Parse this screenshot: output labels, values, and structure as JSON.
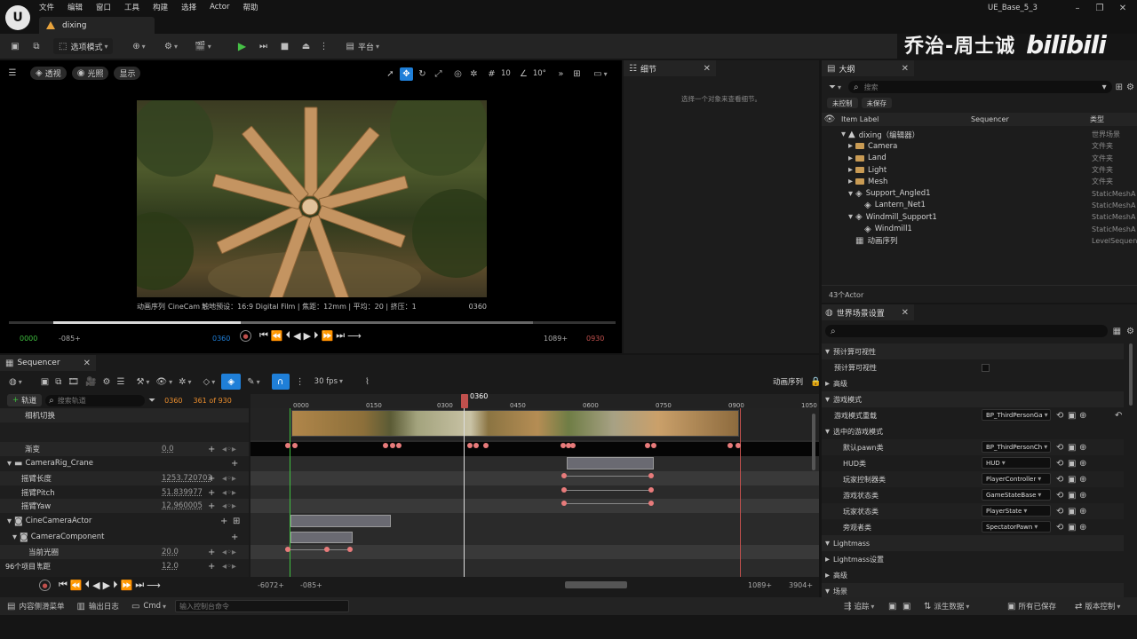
{
  "menu": {
    "items": [
      "文件",
      "编辑",
      "窗口",
      "工具",
      "构建",
      "选择",
      "Actor",
      "帮助"
    ]
  },
  "window": {
    "project": "UE_Base_5_3",
    "level_tab": "dixing"
  },
  "watermark": {
    "text": "乔治-周士诚",
    "logo": "bilibili"
  },
  "toolbar": {
    "mode": "选项模式",
    "platform": "平台"
  },
  "viewport": {
    "perspective": "透视",
    "lighting": "光照",
    "show": "显示",
    "grid_value": "10",
    "angle_value": "10°",
    "caption_left": "动画序列",
    "caption_mid": "CineCam",
    "caption_info": "触地预设：16:9 Digital Film | 焦距：12mm | 平均：20 | 挤压：1",
    "caption_frame": "0360",
    "scrub_start": "0000",
    "scrub_prev": "-085+",
    "scrub_current": "0360",
    "scrub_next": "1089+",
    "scrub_end": "0930",
    "scrub_progress": 0.39
  },
  "details": {
    "title": "细节",
    "empty_text": "选择一个对象来查看细节。"
  },
  "outliner": {
    "title": "大纲",
    "search_placeholder": "搜索",
    "filter_uncontrolled": "未控制",
    "filter_unsaved": "未保存",
    "col_label": "Item Label",
    "col_sequencer": "Sequencer",
    "col_type": "类型",
    "items": [
      {
        "label": "dixing（编辑器）",
        "type": "世界场景"
      },
      {
        "label": "Camera",
        "type": "文件夹"
      },
      {
        "label": "Land",
        "type": "文件夹"
      },
      {
        "label": "Light",
        "type": "文件夹"
      },
      {
        "label": "Mesh",
        "type": "文件夹"
      },
      {
        "label": "Support_Angled1",
        "type": "StaticMeshA"
      },
      {
        "label": "Lantern_Net1",
        "type": "StaticMeshA"
      },
      {
        "label": "Windmill_Support1",
        "type": "StaticMeshA"
      },
      {
        "label": "Windmill1",
        "type": "StaticMeshA"
      },
      {
        "label": "动画序列",
        "type": "LevelSequen"
      }
    ],
    "count": "43个Actor"
  },
  "world_settings": {
    "title": "世界场景设置",
    "search_placeholder": "",
    "sections": {
      "precompute": "预计算可视性",
      "precompute_prop": "预计算可视性",
      "advanced": "高级",
      "game_mode": "游戏模式",
      "game_mode_override": "游戏模式重载",
      "selected_game_mode": "选中的游戏模式",
      "lightmass": "Lightmass",
      "lightmass_settings": "Lightmass设置",
      "advanced2": "高级",
      "world": "场景"
    },
    "props": [
      {
        "label": "默认pawn类",
        "value": "BP_ThirdPersonCh"
      },
      {
        "label": "HUD类",
        "value": "HUD"
      },
      {
        "label": "玩家控制器类",
        "value": "PlayerController"
      },
      {
        "label": "游戏状态类",
        "value": "GameStateBase"
      },
      {
        "label": "玩家状态类",
        "value": "PlayerState"
      },
      {
        "label": "旁观者类",
        "value": "SpectatorPawn"
      }
    ],
    "game_mode_value": "BP_ThirdPersonGa"
  },
  "sequencer": {
    "tab": "Sequencer",
    "fps": "30 fps",
    "sequence_name": "动画序列",
    "add_track": "轨道",
    "search_placeholder": "搜索轨道",
    "current_frame": "0360",
    "frame_of": "361 of 930",
    "playhead_label": "0360",
    "ruler": [
      "0000",
      "0150",
      "0300",
      "0450",
      "0600",
      "0750",
      "0900",
      "1050"
    ],
    "tracks": [
      {
        "label": "相机切换",
        "value": ""
      },
      {
        "label": "渐变",
        "value": "0.0"
      },
      {
        "label": "CameraRig_Crane",
        "value": ""
      },
      {
        "label": "摇臂长度",
        "value": "1253.720703"
      },
      {
        "label": "摇臂Pitch",
        "value": "51.839977"
      },
      {
        "label": "摇臂Yaw",
        "value": "12.960005"
      },
      {
        "label": "CineCameraActor",
        "value": ""
      },
      {
        "label": "CameraComponent",
        "value": ""
      },
      {
        "label": "当前光圈",
        "value": "20.0"
      },
      {
        "label": "焦距",
        "value": "12.0"
      }
    ],
    "item_count": "96个项目",
    "bottom_start": "-6072+",
    "bottom_prev": "-085+",
    "bottom_next": "1089+",
    "bottom_end": "3904+"
  },
  "statusbar": {
    "content_drawer": "内容侧滑菜单",
    "output_log": "输出日志",
    "cmd": "Cmd",
    "cmd_placeholder": "输入控制台命令",
    "trace": "追踪",
    "derived_data": "派生数据",
    "all_saved": "所有已保存",
    "source_control": "版本控制"
  },
  "colors": {
    "accent": "#1f7fd8",
    "playhead": "#c0504d",
    "key": "#e87b7b",
    "green": "#3fbf3f"
  }
}
